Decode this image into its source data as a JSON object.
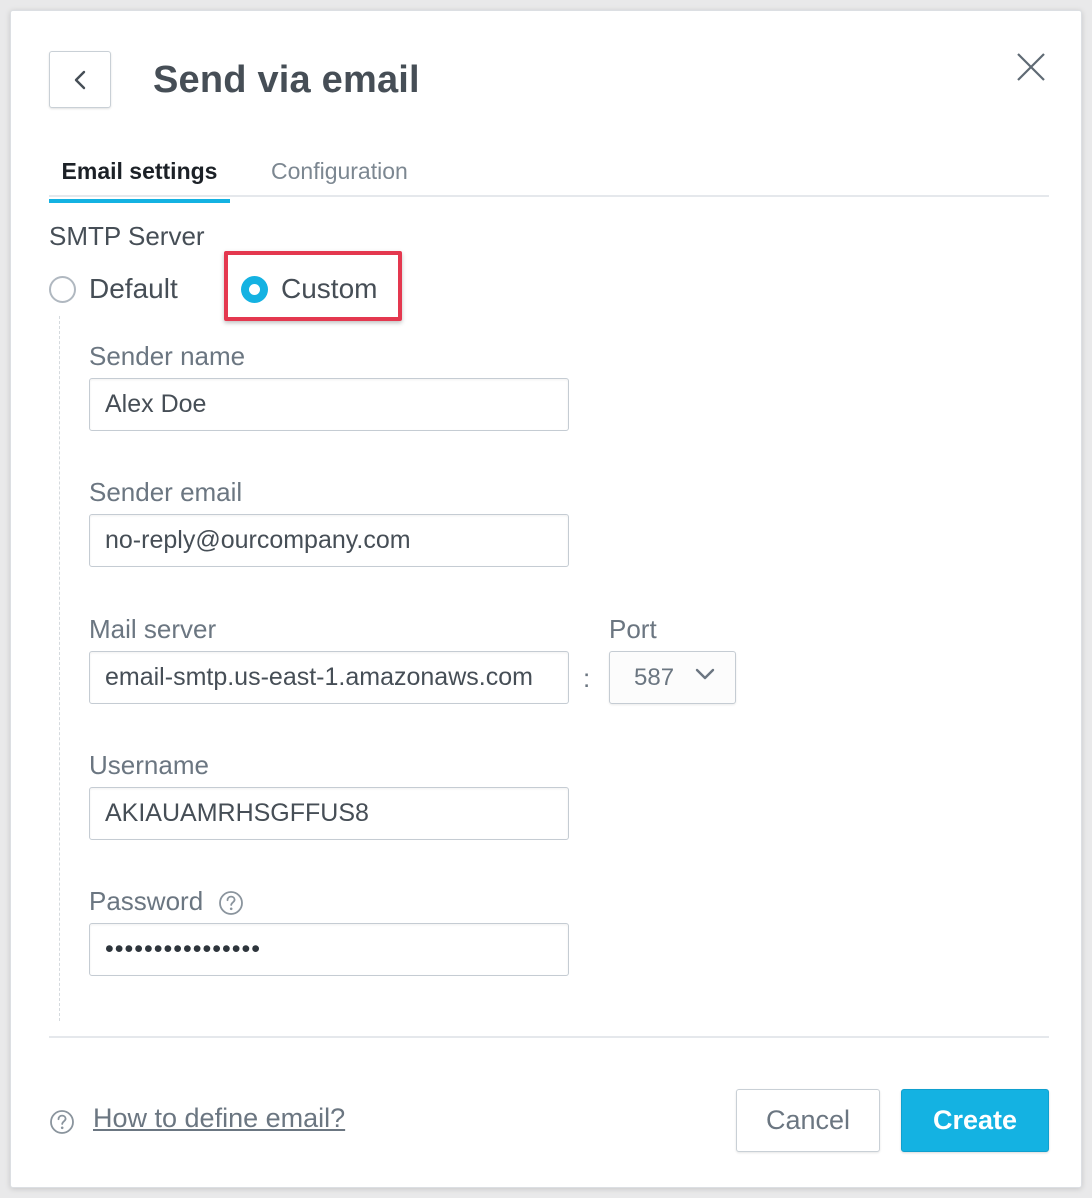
{
  "dialog": {
    "title": "Send via email"
  },
  "icons": {
    "back": "chevron-left-icon",
    "close": "close-icon",
    "dropdown": "chevron-down-icon",
    "help": "question-circle-icon"
  },
  "tabs": [
    {
      "label": "Email settings",
      "active": true
    },
    {
      "label": "Configuration",
      "active": false
    }
  ],
  "smtp": {
    "section_label": "SMTP Server",
    "options": [
      {
        "label": "Default",
        "selected": false
      },
      {
        "label": "Custom",
        "selected": true
      }
    ]
  },
  "form": {
    "sender_name": {
      "label": "Sender name",
      "value": "Alex Doe"
    },
    "sender_email": {
      "label": "Sender email",
      "value": "no-reply@ourcompany.com"
    },
    "mail_server": {
      "label": "Mail server",
      "value": "email-smtp.us-east-1.amazonaws.com"
    },
    "port": {
      "label": "Port",
      "value": "587",
      "separator": ":"
    },
    "username": {
      "label": "Username",
      "value": "AKIAUAMRHSGFFUS8"
    },
    "password": {
      "label": "Password",
      "value": "••••••••••••••••"
    }
  },
  "footer": {
    "help_link": "How to define email?",
    "cancel_label": "Cancel",
    "create_label": "Create"
  },
  "colors": {
    "accent": "#14b2e2",
    "highlight": "#e4384f",
    "text": "#464e56"
  }
}
